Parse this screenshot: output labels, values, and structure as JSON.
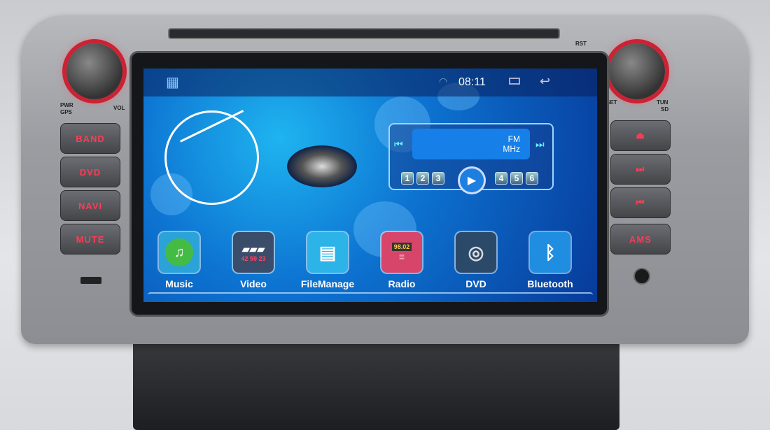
{
  "device": {
    "labels": {
      "pwr": "PWR",
      "gps": "GPS",
      "vol": "VOL",
      "rst": "RST",
      "set": "SET",
      "tun": "TUN",
      "sd": "SD"
    },
    "left_buttons": [
      "BAND",
      "DVD",
      "NAVI",
      "MUTE"
    ],
    "right_buttons": [
      {
        "icon": "eject-icon",
        "glyph": "⏏"
      },
      {
        "icon": "next-track-icon",
        "glyph": "⏭"
      },
      {
        "icon": "previous-track-icon",
        "glyph": "⏮"
      },
      {
        "label": "AMS"
      }
    ]
  },
  "status_bar": {
    "time": "08:11",
    "icons": [
      "apps-grid-icon",
      "wifi-icon",
      "recent-apps-icon",
      "back-icon"
    ]
  },
  "radio_widget": {
    "band": "FM",
    "unit": "MHz",
    "presets": [
      "1",
      "2",
      "3",
      "4",
      "5",
      "6"
    ]
  },
  "apps": [
    {
      "label": "Music",
      "icon": "music-icon",
      "color": "#2ba3d8"
    },
    {
      "label": "Video",
      "icon": "video-clapper-icon",
      "color": "#3a4d6a"
    },
    {
      "label": "FileManage",
      "icon": "folder-icon",
      "color": "#2cb4e8"
    },
    {
      "label": "Radio",
      "icon": "radio-icon",
      "color": "#d8456a",
      "display": "98.02"
    },
    {
      "label": "DVD",
      "icon": "dvd-icon",
      "color": "#2b4a6a"
    },
    {
      "label": "Bluetooth",
      "icon": "bluetooth-icon",
      "color": "#1f8ee0"
    }
  ],
  "video_icon_digits": [
    "42",
    "59",
    "23"
  ]
}
